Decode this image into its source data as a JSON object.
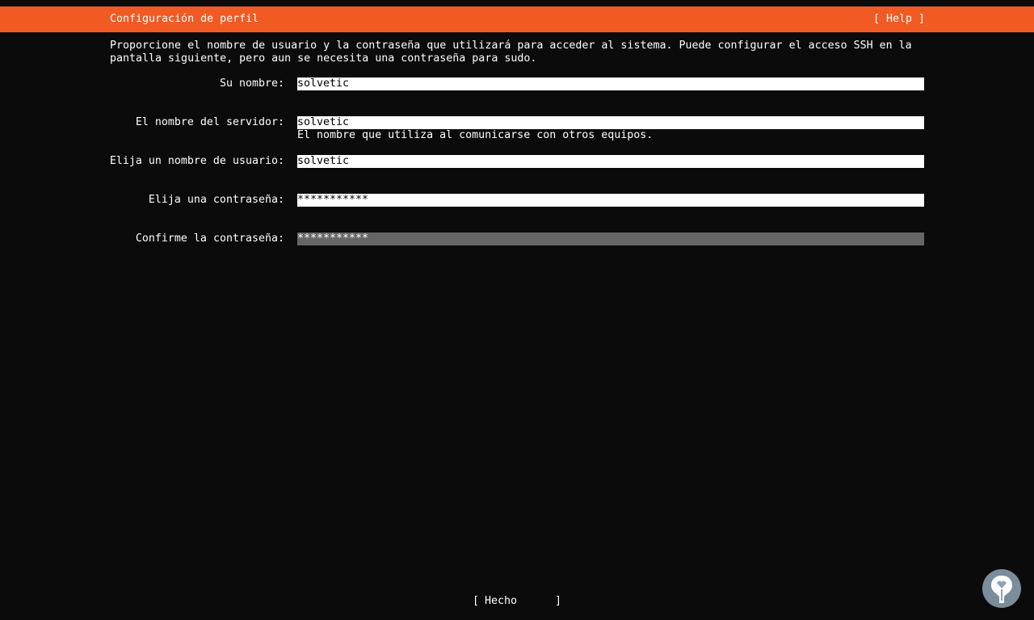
{
  "header": {
    "title": "Configuración de perfil",
    "help_label": "[ Help ]"
  },
  "intro": {
    "line1": "Proporcione el nombre de usuario y la contraseña que utilizará para acceder al sistema. Puede configurar el acceso SSH en la",
    "line2": "pantalla siguiente, pero aun se necesita una contraseña para sudo."
  },
  "form": {
    "name": {
      "label": "Su nombre:",
      "value": "solvetic"
    },
    "server": {
      "label": "El nombre del servidor:",
      "value": "solvetic",
      "hint": "El nombre que utiliza al comunicarse con otros equipos."
    },
    "username": {
      "label": "Elija un nombre de usuario:",
      "value": "solvetic"
    },
    "password": {
      "label": "Elija una contraseña:",
      "value": "***********"
    },
    "confirm": {
      "label": "Confirme la contraseña:",
      "value": "***********",
      "focused": true
    }
  },
  "footer": {
    "done_open": "[",
    "done_label": "Hecho",
    "done_close": "]"
  },
  "colors": {
    "accent": "#f15a22",
    "background": "#0b0b0b",
    "field": "#ffffff",
    "field_focused": "#666666",
    "logo": "#8fa3b4"
  },
  "icons": {
    "watermark": "solvetic-logo-icon"
  }
}
